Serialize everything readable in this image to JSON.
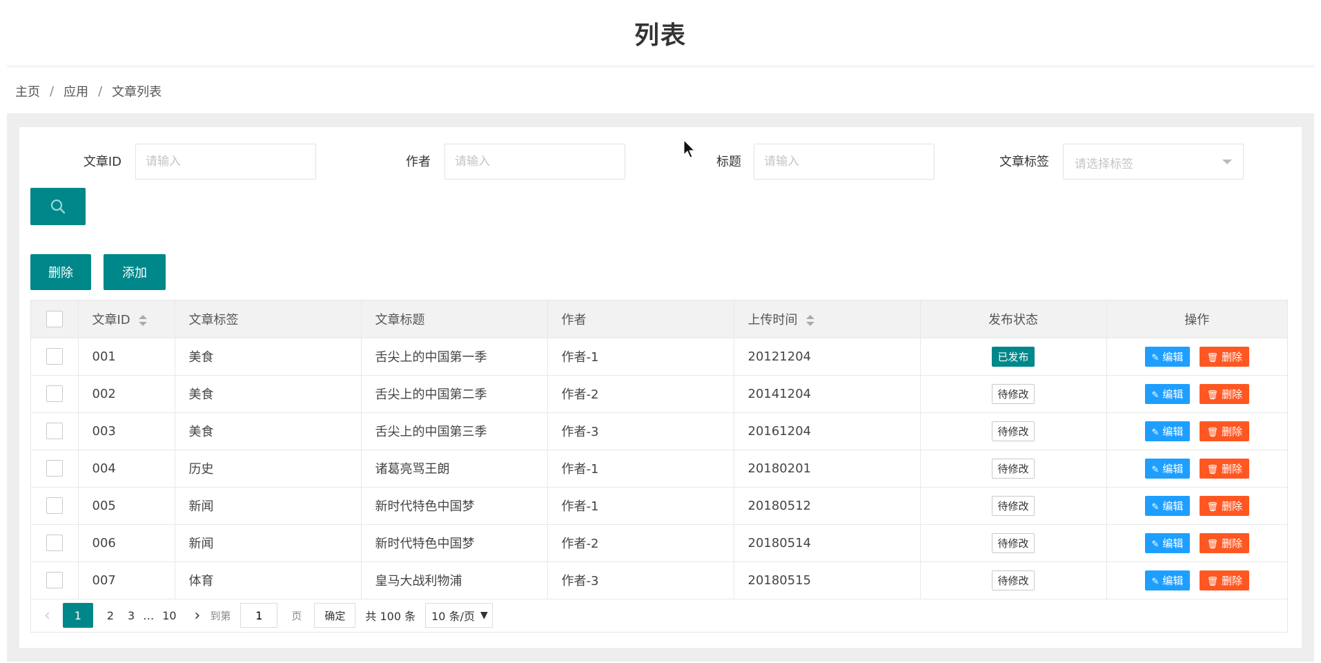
{
  "page": {
    "title": "列表"
  },
  "breadcrumb": {
    "items": [
      "主页",
      "应用",
      "文章列表"
    ],
    "separator": "/"
  },
  "filters": {
    "id_label": "文章ID",
    "id_placeholder": "请输入",
    "author_label": "作者",
    "author_placeholder": "请输入",
    "title_label": "标题",
    "title_placeholder": "请输入",
    "tag_label": "文章标签",
    "tag_placeholder": "请选择标签"
  },
  "search_button": {
    "icon": "search-icon"
  },
  "toolbar": {
    "delete_label": "删除",
    "add_label": "添加"
  },
  "table": {
    "headers": {
      "id": "文章ID",
      "tag": "文章标签",
      "title": "文章标题",
      "author": "作者",
      "time": "上传时间",
      "status": "发布状态",
      "actions": "操作"
    },
    "edit_label": "编辑",
    "delete_label": "删除",
    "rows": [
      {
        "id": "001",
        "tag": "美食",
        "title": "舌尖上的中国第一季",
        "author": "作者-1",
        "time": "20121204",
        "status": "已发布",
        "published": true
      },
      {
        "id": "002",
        "tag": "美食",
        "title": "舌尖上的中国第二季",
        "author": "作者-2",
        "time": "20141204",
        "status": "待修改",
        "published": false
      },
      {
        "id": "003",
        "tag": "美食",
        "title": "舌尖上的中国第三季",
        "author": "作者-3",
        "time": "20161204",
        "status": "待修改",
        "published": false
      },
      {
        "id": "004",
        "tag": "历史",
        "title": "诸葛亮骂王朗",
        "author": "作者-1",
        "time": "20180201",
        "status": "待修改",
        "published": false
      },
      {
        "id": "005",
        "tag": "新闻",
        "title": "新时代特色中国梦",
        "author": "作者-1",
        "time": "20180512",
        "status": "待修改",
        "published": false
      },
      {
        "id": "006",
        "tag": "新闻",
        "title": "新时代特色中国梦",
        "author": "作者-2",
        "time": "20180514",
        "status": "待修改",
        "published": false
      },
      {
        "id": "007",
        "tag": "体育",
        "title": "皇马大战利物浦",
        "author": "作者-3",
        "time": "20180515",
        "status": "待修改",
        "published": false
      }
    ]
  },
  "pagination": {
    "prev": "‹",
    "pages": [
      "1",
      "2",
      "3"
    ],
    "ellipsis": "…",
    "last_page": "10",
    "next": "›",
    "goto_label": "到第",
    "goto_value": "1",
    "page_unit": "页",
    "confirm_label": "确定",
    "total_text": "共 100 条",
    "page_size": "10 条/页"
  },
  "colors": {
    "accent": "#00878a",
    "edit": "#1e9fff",
    "danger": "#ff5722"
  }
}
